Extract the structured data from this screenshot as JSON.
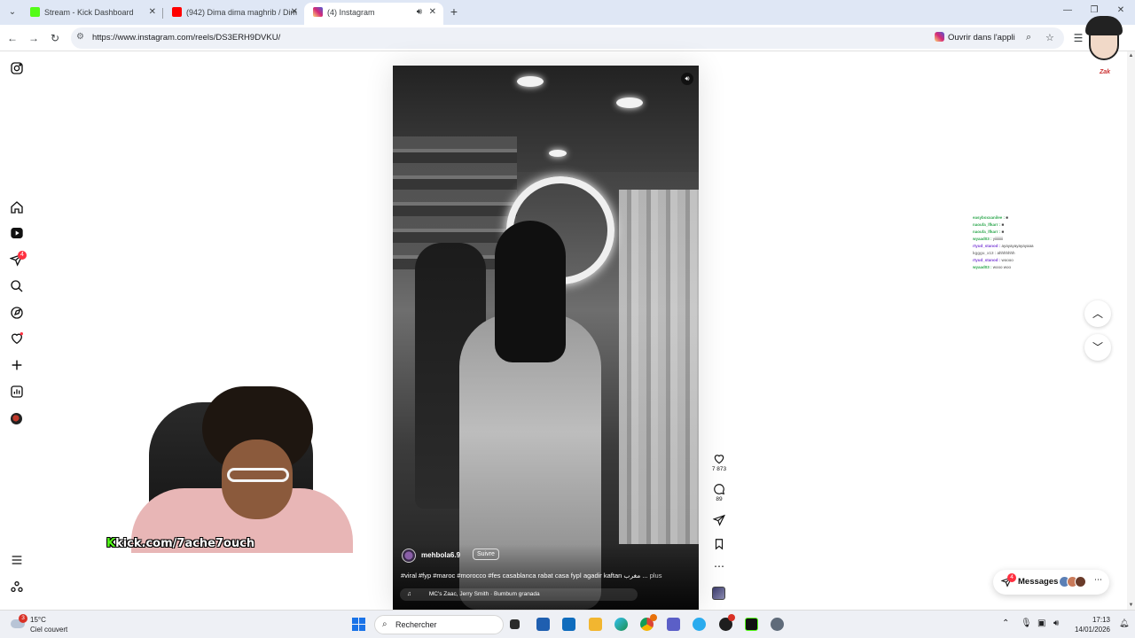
{
  "browser": {
    "tabs": [
      {
        "title": "Stream - Kick Dashboard",
        "favicon_color": "#53fc18"
      },
      {
        "title": "(942) Dima dima maghrib / Dim",
        "favicon_color": "#ff0000"
      },
      {
        "title": "(4) Instagram",
        "favicon_color": "#d62976"
      }
    ],
    "url": "https://www.instagram.com/reels/DS3ERH9DVKU/",
    "open_in_app": "Ouvrir dans l'appli"
  },
  "instagram": {
    "nav": {
      "notifications_badge": "4",
      "icons": [
        "instagram-icon",
        "home-icon",
        "reels-icon",
        "direct-icon",
        "search-icon",
        "explore-icon",
        "heart-icon",
        "create-icon",
        "dashboard-icon",
        "profile-avatar",
        "menu-icon",
        "threads-icon"
      ]
    },
    "reel": {
      "author": "mehbola6.9",
      "follow_label": "Suivre",
      "caption": "#viral #fyp #maroc #morocco #fes casablanca rabat casa fypا agadir kaftan مغرب ...",
      "more_label": "plus",
      "music": "MC's Zaac, Jerry Smith · Bumbum granada",
      "likes": "7 873",
      "comments": "89"
    },
    "messages": {
      "label": "Messages",
      "badge": "4"
    }
  },
  "chat_overlay": [
    {
      "user": "easyboxxanilee :",
      "msg": "■",
      "color": "#2fa84f"
    },
    {
      "user": "naoufa_lfkarr :",
      "msg": "■",
      "color": "#2fa84f"
    },
    {
      "user": "naoufa_lfkarr :",
      "msg": "■",
      "color": "#2fa84f"
    },
    {
      "user": "wyaad03 :",
      "msg": "yiiiiiiiii",
      "color": "#2fa84f"
    },
    {
      "user": "rtyud_stanod :",
      "msg": "ayayayayayayaaa",
      "color": "#7b3fd6"
    },
    {
      "user": "kgggu_x13 :",
      "msg": "ahhhhhhh",
      "color": "#888888"
    },
    {
      "user": "rtyud_stanod :",
      "msg": "woooo",
      "color": "#7b3fd6"
    },
    {
      "user": "wyaad03 :",
      "msg": "wooo woo",
      "color": "#2fa84f"
    }
  ],
  "webcam": {
    "tag_k": "K",
    "tag_rest": "kick.com/7ache7ouch"
  },
  "cartoon_tag": "Zak",
  "taskbar": {
    "weather_badge": "3",
    "temperature": "15°C",
    "condition": "Ciel couvert",
    "search_placeholder": "Rechercher",
    "time": "17:13",
    "date": "14/01/2026"
  }
}
